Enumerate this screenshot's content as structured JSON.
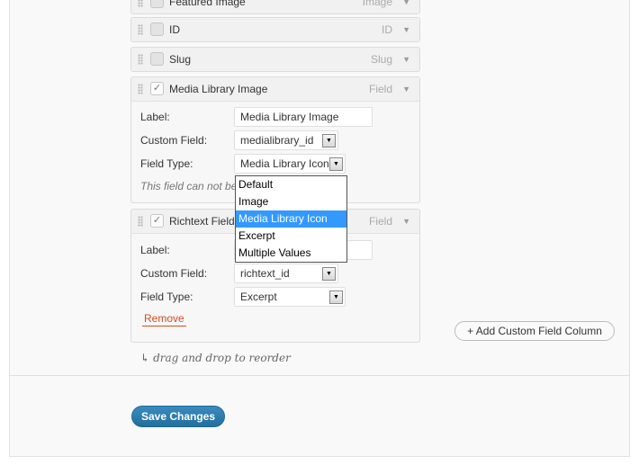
{
  "columns": [
    {
      "title": "Featured Image",
      "type": "Image",
      "checked": false
    },
    {
      "title": "ID",
      "type": "ID",
      "checked": false
    },
    {
      "title": "Slug",
      "type": "Slug",
      "checked": false
    },
    {
      "title": "Media Library Image",
      "type": "Field",
      "checked": true,
      "label_caption": "Label:",
      "label_value": "Media Library Image",
      "custom_field_caption": "Custom Field:",
      "custom_field_value": "medialibrary_id",
      "field_type_caption": "Field Type:",
      "field_type_value": "Media Library Icon",
      "note": "This field can not be"
    },
    {
      "title": "Richtext Field",
      "type": "Field",
      "checked": true,
      "label_caption": "Label:",
      "label_value": "",
      "custom_field_caption": "Custom Field:",
      "custom_field_value": "richtext_id",
      "field_type_caption": "Field Type:",
      "field_type_value": "Excerpt",
      "remove_label": "Remove"
    }
  ],
  "field_type_dropdown": {
    "options": [
      "Default",
      "Image",
      "Media Library Icon",
      "Excerpt",
      "Multiple Values"
    ],
    "selected": "Media Library Icon"
  },
  "checkmark": "✓",
  "add_column_label": "+ Add Custom Field Column",
  "drag_hint": "drag and drop to reorder",
  "drag_hint_icon": "↳",
  "save_label": "Save Changes",
  "colors": {
    "accent": "#2a7bb0",
    "selected_option": "#3399ff",
    "remove": "#d54e21"
  }
}
